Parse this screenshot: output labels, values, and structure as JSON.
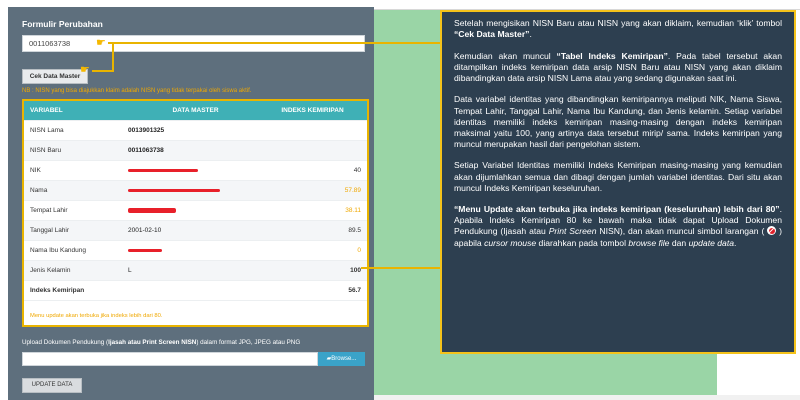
{
  "form": {
    "title": "Formulir Perubahan",
    "nisn_value": "0011063738",
    "check_button": "Cek Data Master",
    "note": "NB : NISN yang bisa diajukkan klaim adalah NISN yang tidak terpakai oleh siswa aktif."
  },
  "table": {
    "headers": [
      "VARIABEL",
      "DATA MASTER",
      "INDEKS KEMIRIPAN"
    ],
    "rows": [
      {
        "variable": "NISN Lama",
        "master": "0013901325",
        "index": ""
      },
      {
        "variable": "NISN Baru",
        "master": "0011063738",
        "index": ""
      },
      {
        "variable": "NIK",
        "master": "",
        "index": "40"
      },
      {
        "variable": "Nama",
        "master": "",
        "index": "57.89"
      },
      {
        "variable": "Tempat Lahir",
        "master": "",
        "index": "38.11"
      },
      {
        "variable": "Tanggal Lahir",
        "master": "2001-02-10",
        "index": "89.5"
      },
      {
        "variable": "Nama Ibu Kandung",
        "master": "",
        "index": "0"
      },
      {
        "variable": "Jenis Kelamin",
        "master": "L",
        "index": "100"
      }
    ],
    "overall": {
      "label": "Indeks Kemiripan",
      "value": "56.7"
    },
    "footer_note": "Menu update akan terbuka jika indeks lebih dari 80."
  },
  "upload": {
    "label_prefix": "Upload Dokumen Pendukung (",
    "label_bold": "Ijasah atau Print Screen NISN",
    "label_suffix": ") dalam format JPG, JPEG atau PNG",
    "browse_button": "Browse...",
    "update_button": "UPDATE DATA"
  },
  "callout": {
    "p1_a": "Setelah mengisikan NISN Baru atau NISN yang akan diklaim, kemudian ‘klik’ tombol ",
    "p1_b": "“Cek Data Master”",
    "p1_c": ".",
    "p2_a": "Kemudian akan muncul ",
    "p2_b": "“Tabel Indeks Kemiripan”",
    "p2_c": ". Pada tabel tersebut akan ditampilkan indeks kemiripan data arsip NISN Baru atau NISN yang akan diklaim dibandingkan data arsip NISN Lama atau yang sedang digunakan saat ini.",
    "p3": "Data variabel identitas yang dibandingkan kemiripannya meliputi NIK, Nama Siswa, Tempat Lahir, Tanggal Lahir, Nama Ibu Kandung, dan Jenis kelamin. Setiap variabel identitas memiliki indeks kemiripan masing-masing dengan indeks kemiripan maksimal yaitu 100, yang artinya data tersebut mirip/ sama. Indeks kemiripan yang muncul merupakan hasil dari pengelohan sistem.",
    "p4": "Setiap Variabel Identitas memiliki Indeks Kemiripan masing-masing yang kemudian akan dijumlahkan semua dan dibagi dengan jumlah variabel identitas. Dari situ akan muncul Indeks Kemiripan keseluruhan.",
    "p5_a": "“Menu Update akan terbuka jika indeks kemiripan (keseluruhan) lebih dari 80”",
    "p5_b": ". Apabila Indeks Kemiripan 80 ke bawah maka tidak dapat Upload Dokumen Pendukung (Ijasah atau ",
    "p5_c": "Print Screen",
    "p5_d": " NISN), dan akan muncul simbol larangan ( ",
    "p5_e": " ) apabila ",
    "p5_f": "cursor mouse",
    "p5_g": " diarahkan pada tombol ",
    "p5_h": "browse file",
    "p5_i": " dan ",
    "p5_j": "update data",
    "p5_k": "."
  },
  "icons": {
    "pointer": "hand-pointer-icon",
    "folder": "folder-icon",
    "ban": "ban-icon"
  },
  "colors": {
    "accent": "#f4c21a",
    "table_header": "#3fb0b6",
    "panel": "#5e6f7d",
    "callout_bg": "#2d3f50",
    "warning_text": "#f0a800"
  }
}
